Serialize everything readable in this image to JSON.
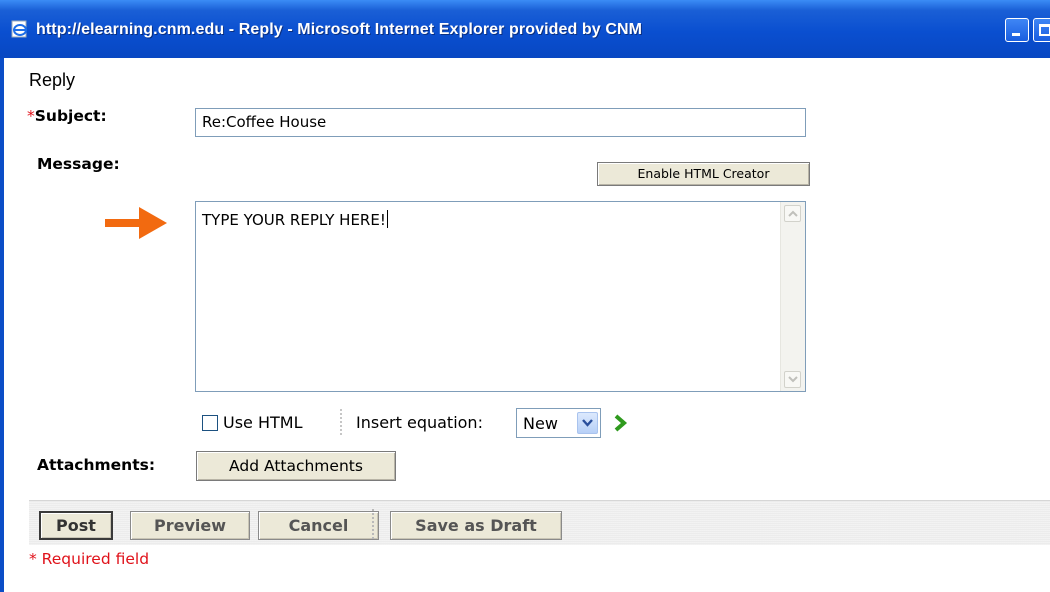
{
  "window": {
    "title": "http://elearning.cnm.edu - Reply - Microsoft Internet Explorer provided by CNM",
    "icon": "ie-page-icon"
  },
  "form": {
    "heading": "Reply",
    "required_marker": "*",
    "subject_label": "Subject:",
    "subject_value": "Re:Coffee House",
    "message_label": "Message:",
    "enable_html_creator": "Enable HTML Creator",
    "message_value": "TYPE YOUR REPLY HERE!",
    "use_html_label": "Use HTML",
    "use_html_checked": false,
    "insert_equation_label": "Insert equation:",
    "equation_selected": "New",
    "attachments_label": "Attachments:",
    "add_attachments": "Add Attachments"
  },
  "actions": {
    "post": "Post",
    "preview": "Preview",
    "cancel": "Cancel",
    "save_draft": "Save as Draft"
  },
  "required_note": "* Required field",
  "colors": {
    "titlebar": "#0a4fd0",
    "required": "#e0121a",
    "pointer_arrow": "#f26a10",
    "go_arrow": "#2f9a1e"
  }
}
